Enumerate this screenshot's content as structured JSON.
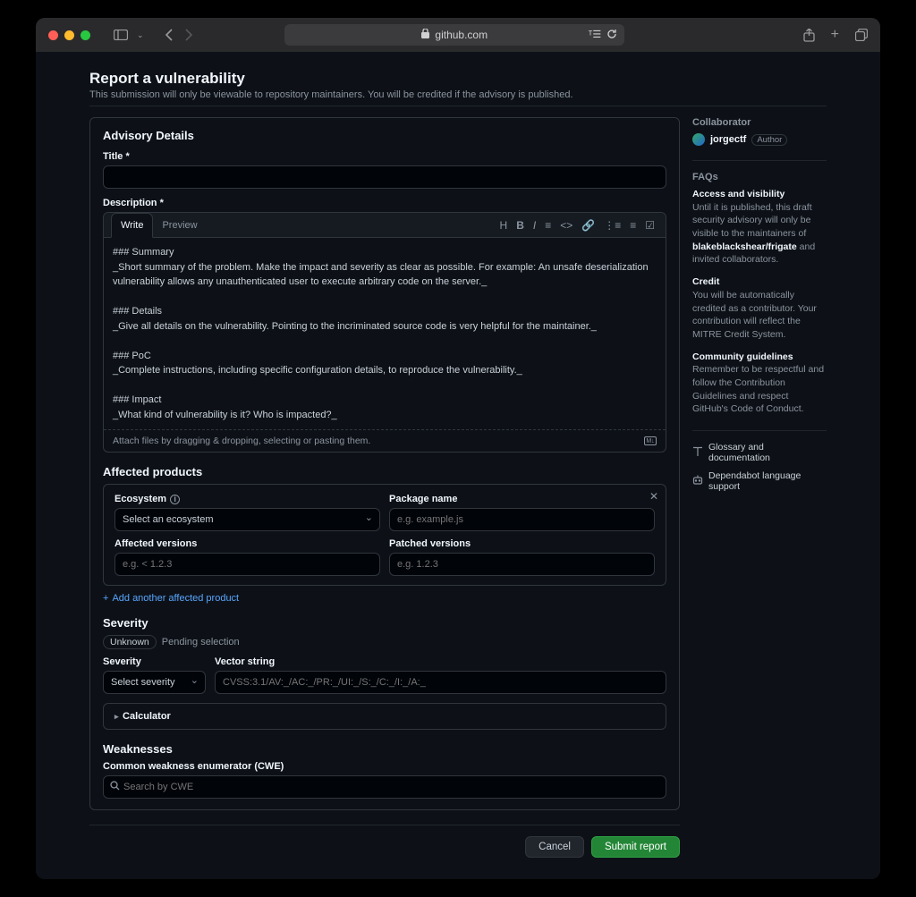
{
  "browser": {
    "url": "github.com"
  },
  "header": {
    "title": "Report a vulnerability",
    "subtitle": "This submission will only be viewable to repository maintainers. You will be credited if the advisory is published."
  },
  "advisory": {
    "panel_title": "Advisory Details",
    "title_label": "Title *",
    "title_value": "",
    "description_label": "Description *",
    "tabs": {
      "write": "Write",
      "preview": "Preview"
    },
    "description_value": "### Summary\n_Short summary of the problem. Make the impact and severity as clear as possible. For example: An unsafe deserialization vulnerability allows any unauthenticated user to execute arbitrary code on the server._\n\n### Details\n_Give all details on the vulnerability. Pointing to the incriminated source code is very helpful for the maintainer._\n\n### PoC\n_Complete instructions, including specific configuration details, to reproduce the vulnerability._\n\n### Impact\n_What kind of vulnerability is it? Who is impacted?_",
    "attach_hint": "Attach files by dragging & dropping, selecting or pasting them."
  },
  "products": {
    "heading": "Affected products",
    "ecosystem_label": "Ecosystem",
    "ecosystem_value": "Select an ecosystem",
    "package_label": "Package name",
    "package_placeholder": "e.g. example.js",
    "affected_label": "Affected versions",
    "affected_placeholder": "e.g. < 1.2.3",
    "patched_label": "Patched versions",
    "patched_placeholder": "e.g. 1.2.3",
    "add_link": "Add another affected product"
  },
  "severity": {
    "heading": "Severity",
    "badge": "Unknown",
    "pending": "Pending selection",
    "severity_label": "Severity",
    "severity_value": "Select severity",
    "vector_label": "Vector string",
    "vector_placeholder": "CVSS:3.1/AV:_/AC:_/PR:_/UI:_/S:_/C:_/I:_/A:_",
    "calculator": "Calculator"
  },
  "weaknesses": {
    "heading": "Weaknesses",
    "cwe_label": "Common weakness enumerator (CWE)",
    "cwe_placeholder": "Search by CWE"
  },
  "actions": {
    "cancel": "Cancel",
    "submit": "Submit report"
  },
  "sidebar": {
    "collaborator_title": "Collaborator",
    "collab_name": "jorgectf",
    "author": "Author",
    "faqs_title": "FAQs",
    "access_title": "Access and visibility",
    "access_text1": "Until it is published, this draft security advisory will only be visible to the maintainers of ",
    "access_repo": "blakeblackshear/frigate",
    "access_text2": " and invited collaborators.",
    "credit_title": "Credit",
    "credit_text": "You will be automatically credited as a contributor. Your contribution will reflect the MITRE Credit System.",
    "guidelines_title": "Community guidelines",
    "guidelines_text": "Remember to be respectful and follow the Contribution Guidelines and respect GitHub's Code of Conduct.",
    "glossary": "Glossary and documentation",
    "dependabot": "Dependabot language support"
  }
}
